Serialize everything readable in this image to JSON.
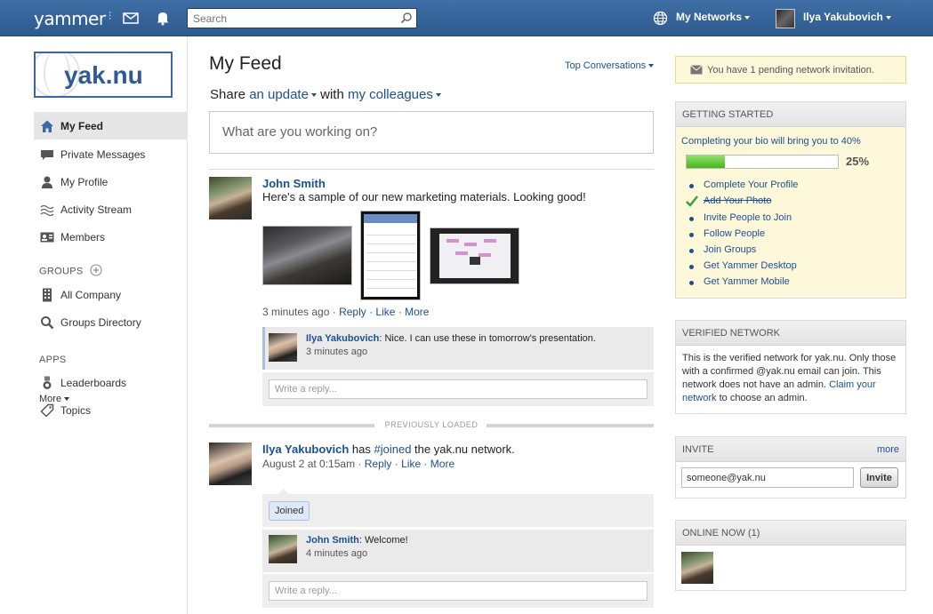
{
  "topbar": {
    "logo": "yammer",
    "search_placeholder": "Search",
    "networks_label": "My Networks",
    "user_name": "Ilya Yakubovich"
  },
  "sidebar": {
    "network_logo_text": "yak.nu",
    "items": [
      {
        "label": "My Feed",
        "icon": "home-icon",
        "active": true
      },
      {
        "label": "Private Messages",
        "icon": "envelope-icon"
      },
      {
        "label": "My Profile",
        "icon": "person-icon"
      },
      {
        "label": "Activity Stream",
        "icon": "wave-icon"
      },
      {
        "label": "Members",
        "icon": "id-card-icon"
      }
    ],
    "groups_title": "GROUPS",
    "groups": [
      {
        "label": "All Company",
        "icon": "building-icon"
      },
      {
        "label": "Groups Directory",
        "icon": "magnifier-icon"
      }
    ],
    "apps_title": "APPS",
    "apps": [
      {
        "label": "Leaderboards",
        "icon": "medal-icon"
      },
      {
        "label": "Topics",
        "icon": "tag-icon"
      }
    ],
    "more_label": "More"
  },
  "feed": {
    "title": "My Feed",
    "top_conversations": "Top Conversations",
    "share_prefix": "Share",
    "share_type": "an update",
    "share_with": "with",
    "share_audience": "my colleagues",
    "composer_placeholder": "What are you working on?",
    "post1": {
      "author": "John Smith",
      "text": "Here's a sample of our new marketing materials. Looking good!",
      "time": "3 minutes ago",
      "actions": [
        "Reply",
        "Like",
        "More"
      ],
      "reply": {
        "author": "Ilya Yakubovich",
        "text": ": Nice. I can use these in tomorrow's presentation.",
        "time": "3 minutes ago"
      },
      "reply_placeholder": "Write a reply..."
    },
    "previously_loaded": "PREVIOUSLY LOADED",
    "post2": {
      "author": "Ilya Yakubovich",
      "text_before": " has ",
      "hashtag": "#joined",
      "text_after": " the yak.nu network.",
      "time": "August 2 at 0:15am",
      "actions": [
        "Reply",
        "Like",
        "More"
      ],
      "tag": "Joined",
      "reply": {
        "author": "John Smith",
        "text": ": Welcome!",
        "time": "4 minutes ago"
      },
      "reply_placeholder": "Write a reply..."
    }
  },
  "right": {
    "invitation_notice": "You have 1 pending network invitation.",
    "getting_started": {
      "title": "GETTING STARTED",
      "subtitle": "Completing your bio will bring you to 40%",
      "progress": 0.25,
      "progress_label": "25%",
      "items": [
        {
          "label": "Complete Your Profile",
          "done": false
        },
        {
          "label": "Add Your Photo",
          "done": true
        },
        {
          "label": "Invite People to Join",
          "done": false
        },
        {
          "label": "Follow People",
          "done": false
        },
        {
          "label": "Join Groups",
          "done": false
        },
        {
          "label": "Get Yammer Desktop",
          "done": false
        },
        {
          "label": "Get Yammer Mobile",
          "done": false
        }
      ]
    },
    "verified": {
      "title": "VERIFIED NETWORK",
      "text": "This is the verified network for yak.nu. Only those with a confirmed @yak.nu email can join. This network does not have an admin.",
      "claim_link": "Claim your network",
      "claim_suffix": " to choose an admin."
    },
    "invite": {
      "title": "INVITE",
      "more": "more",
      "input_value": "someone@yak.nu",
      "button": "Invite"
    },
    "online": {
      "title": "ONLINE NOW (1)"
    }
  },
  "colors": {
    "topbar": "#2d5a8f",
    "link": "#1d4f91",
    "notice_bg": "#fdf8d9",
    "progress_fill": "#48b51f"
  }
}
